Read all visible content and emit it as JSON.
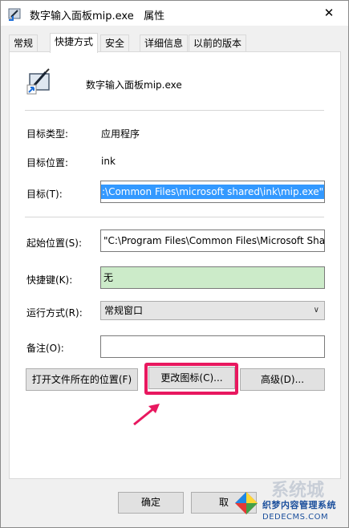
{
  "window": {
    "title": "数字输入面板mip.exe   属性",
    "close_glyph": "✕"
  },
  "tabs": [
    {
      "label": "常规"
    },
    {
      "label": "快捷方式"
    },
    {
      "label": "安全"
    },
    {
      "label": "详细信息"
    },
    {
      "label": "以前的版本"
    }
  ],
  "app": {
    "name": "数字输入面板mip.exe",
    "icon": "pen-tablet-shortcut-icon"
  },
  "fields": {
    "target_type_label": "目标类型:",
    "target_type_value": "应用程序",
    "target_location_label": "目标位置:",
    "target_location_value": "ink",
    "target_label": "目标(T):",
    "target_value": ":\\Common Files\\microsoft shared\\ink\\mip.exe\"",
    "start_in_label": "起始位置(S):",
    "start_in_value": "\"C:\\Program Files\\Common Files\\Microsoft Sha",
    "shortcut_key_label": "快捷键(K):",
    "shortcut_key_value": "无",
    "run_label": "运行方式(R):",
    "run_value": "常规窗口",
    "comment_label": "备注(O):",
    "comment_value": ""
  },
  "buttons": {
    "open_location": "打开文件所在的位置(F)",
    "change_icon": "更改图标(C)...",
    "advanced": "高级(D)...",
    "ok": "确定",
    "cancel": "取"
  },
  "watermark": {
    "line1": "织梦内容管理系统",
    "line2": "DEDECMS.COM",
    "big": "系统城"
  },
  "colors": {
    "highlight": "#e8185f",
    "selection": "#3399ff",
    "shortcut_bg": "#ccebc9"
  }
}
